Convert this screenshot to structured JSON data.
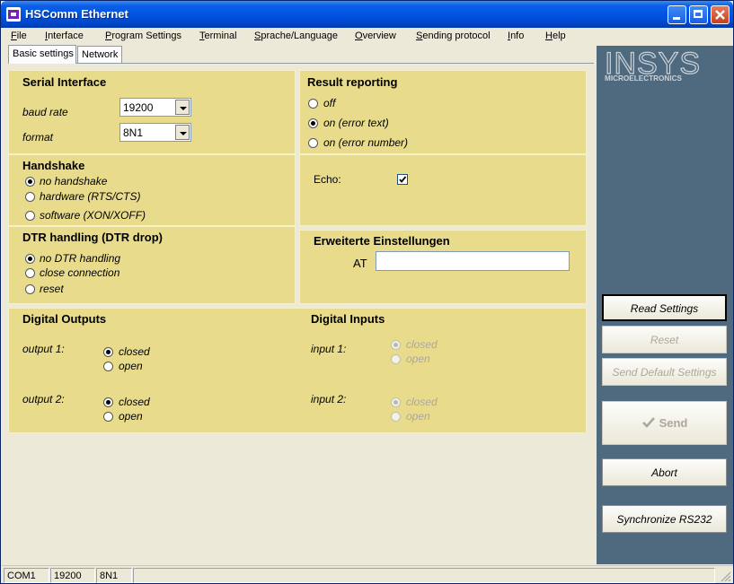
{
  "window": {
    "title": "HSComm Ethernet"
  },
  "menu": [
    "File",
    "Interface",
    "Program Settings",
    "Terminal",
    "Sprache/Language",
    "Overview",
    "Sending protocol",
    "Info",
    "Help"
  ],
  "tabs": [
    "Basic settings",
    "Network"
  ],
  "serial": {
    "title": "Serial Interface",
    "baud_label": "baud rate",
    "baud_value": "19200",
    "format_label": "format",
    "format_value": "8N1"
  },
  "result": {
    "title": "Result reporting",
    "options": [
      "off",
      "on (error text)",
      "on (error number)"
    ],
    "selected": 1
  },
  "handshake": {
    "title": "Handshake",
    "options": [
      "no handshake",
      "hardware (RTS/CTS)",
      "software (XON/XOFF)"
    ],
    "selected": 0
  },
  "echo": {
    "label": "Echo:",
    "checked": true
  },
  "dtr": {
    "title": "DTR handling (DTR drop)",
    "options": [
      "no DTR handling",
      "close connection",
      "reset"
    ],
    "selected": 0
  },
  "extended": {
    "title": "Erweiterte Einstellungen",
    "at_label": "AT",
    "at_value": ""
  },
  "digital_outputs": {
    "title": "Digital Outputs",
    "outputs": [
      {
        "label": "output 1:",
        "options": [
          "closed",
          "open"
        ],
        "selected": 0
      },
      {
        "label": "output 2:",
        "options": [
          "closed",
          "open"
        ],
        "selected": 0
      }
    ]
  },
  "digital_inputs": {
    "title": "Digital Inputs",
    "inputs": [
      {
        "label": "input 1:",
        "options": [
          "closed",
          "open"
        ],
        "selected": 0
      },
      {
        "label": "input 2:",
        "options": [
          "closed",
          "open"
        ],
        "selected": 0
      }
    ]
  },
  "logo": {
    "text": "INSYS",
    "subtitle": "MICROELECTRONICS"
  },
  "buttons": {
    "read_settings": "Read Settings",
    "reset": "Reset",
    "send_default": "Send Default Settings",
    "send": "Send",
    "abort": "Abort",
    "synchronize": "Synchronize RS232"
  },
  "status": [
    "COM1",
    "19200",
    "8N1"
  ],
  "colors": {
    "panel": "#e8dc8c",
    "sidebar": "#4f6a7e",
    "titlebar": "#0054e3"
  }
}
